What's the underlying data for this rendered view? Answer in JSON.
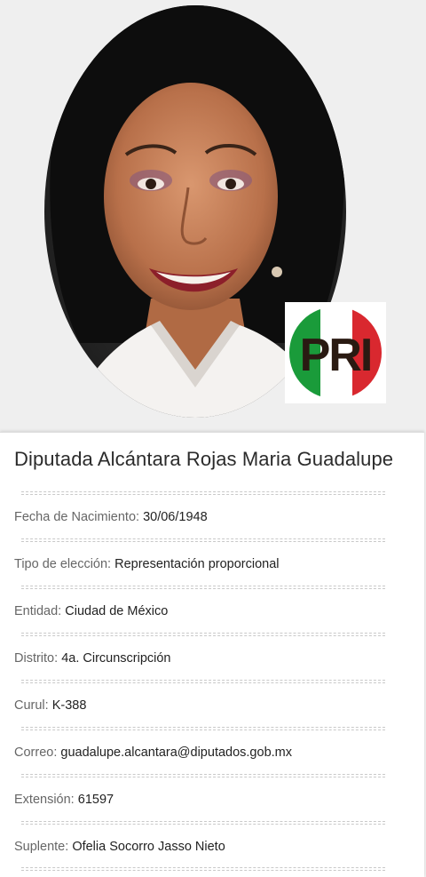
{
  "profile": {
    "title": "Diputada Alcántara Rojas Maria Guadalupe",
    "party_logo": {
      "text": "PRI",
      "colors": {
        "green": "#1a9b3a",
        "white": "#ffffff",
        "red": "#d9282f",
        "letters": "#2a1a12"
      }
    },
    "fields": [
      {
        "label": "Fecha de Nacimiento:",
        "value": "30/06/1948"
      },
      {
        "label": "Tipo de elección:",
        "value": "Representación proporcional"
      },
      {
        "label": "Entidad:",
        "value": "Ciudad de México"
      },
      {
        "label": "Distrito:",
        "value": "4a. Circunscripción"
      },
      {
        "label": "Curul:",
        "value": "K-388"
      },
      {
        "label": "Correo:",
        "value": "guadalupe.alcantara@diputados.gob.mx"
      },
      {
        "label": "Extensión:",
        "value": "61597"
      },
      {
        "label": "Suplente:",
        "value": "Ofelia Socorro Jasso Nieto"
      }
    ]
  }
}
